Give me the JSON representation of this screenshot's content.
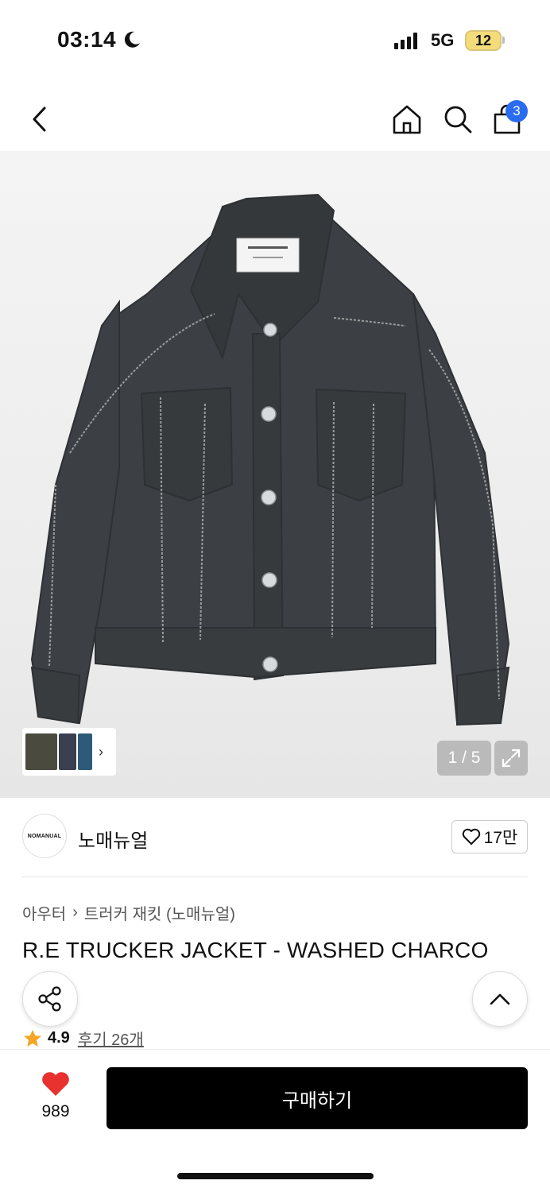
{
  "status": {
    "time": "03:14",
    "network": "5G",
    "battery": "12"
  },
  "nav": {
    "cart_count": "3"
  },
  "gallery": {
    "pager": "1 / 5",
    "thumb_colors": [
      "#4a4a3e",
      "#3a4050",
      "#2d5a78"
    ]
  },
  "brand": {
    "logo_text": "NOMANUAL",
    "name": "노매뉴얼",
    "like_count": "17만"
  },
  "breadcrumb": {
    "category": "아우터",
    "subcategory": "트러커 재킷 (노매뉴얼)"
  },
  "product": {
    "title": "R.E TRUCKER JACKET - WASHED CHARCO"
  },
  "rating": {
    "value": "4.9",
    "reviews": "후기 26개"
  },
  "bottom": {
    "wish_count": "989",
    "buy_label": "구매하기"
  },
  "colors": {
    "cart_badge": "#2a6cf0",
    "heart": "#e8322f",
    "star": "#f5a623",
    "jacket": "#3c4044"
  }
}
